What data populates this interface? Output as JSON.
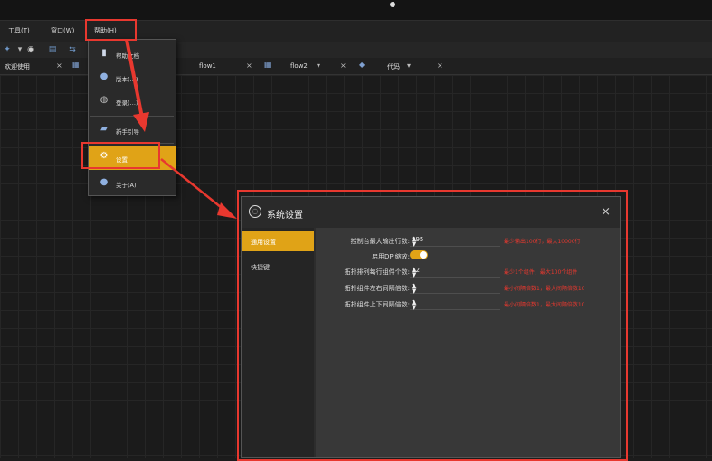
{
  "menubar": {
    "items": [
      {
        "label": "工具(T)"
      },
      {
        "label": "窗口(W)"
      },
      {
        "label": "帮助(H)"
      }
    ]
  },
  "toolbar": {
    "icons": [
      "gear-icon",
      "play-icon",
      "chart-icon",
      "flow-icon"
    ]
  },
  "tabs": [
    {
      "label": "欢迎使用"
    },
    {
      "label": "flow1"
    },
    {
      "label": "flow2"
    },
    {
      "label": "代码"
    }
  ],
  "help_menu": {
    "items": [
      {
        "label": "帮助文档"
      },
      {
        "label": "版本(…)"
      },
      {
        "label": "登录(…)"
      },
      {
        "label": "新手引导"
      },
      {
        "label": "设置"
      },
      {
        "label": "关于(A)"
      }
    ]
  },
  "dialog": {
    "title": "系统设置",
    "close": "×",
    "nav": [
      {
        "label": "通用设置"
      },
      {
        "label": "快捷键"
      }
    ],
    "rows": [
      {
        "label": "控制台最大输出行数:",
        "value": "895",
        "hint": "最少输出100行，最大10000行"
      },
      {
        "label": "启用DPI缩放:",
        "toggle_on": true
      },
      {
        "label": "拓扑排列每行组件个数:",
        "value": "12",
        "hint": "最少1个组件，最大100个组件"
      },
      {
        "label": "拓扑组件左右间隔倍数:",
        "value": "2",
        "hint": "最小间隔倍数1，最大间隔倍数10"
      },
      {
        "label": "拓扑组件上下间隔倍数:",
        "value": "2",
        "hint": "最小间隔倍数1，最大间隔倍数10"
      }
    ]
  },
  "colors": {
    "accent": "#e0a317",
    "highlight": "#e8382f",
    "background": "#1c1c1c"
  }
}
